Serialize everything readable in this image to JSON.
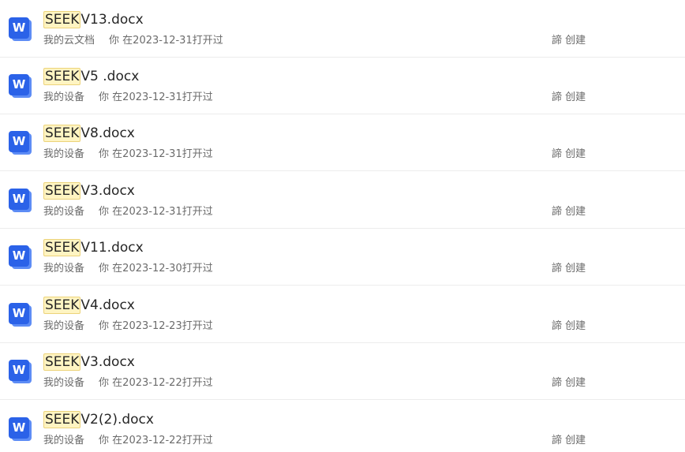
{
  "files": [
    {
      "highlight": "SEEK",
      "name_rest": "V13.docx",
      "location": "我的云文档",
      "opened_by": "你",
      "opened_text": "在2023-12-31打开过",
      "creator": "諦 创建",
      "icon_letter": "W"
    },
    {
      "highlight": "SEEK",
      "name_rest": "V5 .docx",
      "location": "我的设备",
      "opened_by": "你",
      "opened_text": "在2023-12-31打开过",
      "creator": "諦 创建",
      "icon_letter": "W"
    },
    {
      "highlight": "SEEK",
      "name_rest": "V8.docx",
      "location": "我的设备",
      "opened_by": "你",
      "opened_text": "在2023-12-31打开过",
      "creator": "諦 创建",
      "icon_letter": "W"
    },
    {
      "highlight": "SEEK",
      "name_rest": "V3.docx",
      "location": "我的设备",
      "opened_by": "你",
      "opened_text": "在2023-12-31打开过",
      "creator": "諦 创建",
      "icon_letter": "W"
    },
    {
      "highlight": "SEEK",
      "name_rest": "V11.docx",
      "location": "我的设备",
      "opened_by": "你",
      "opened_text": "在2023-12-30打开过",
      "creator": "諦 创建",
      "icon_letter": "W"
    },
    {
      "highlight": "SEEK",
      "name_rest": "V4.docx",
      "location": "我的设备",
      "opened_by": "你",
      "opened_text": "在2023-12-23打开过",
      "creator": "諦 创建",
      "icon_letter": "W"
    },
    {
      "highlight": "SEEK",
      "name_rest": "V3.docx",
      "location": "我的设备",
      "opened_by": "你",
      "opened_text": "在2023-12-22打开过",
      "creator": "諦 创建",
      "icon_letter": "W"
    },
    {
      "highlight": "SEEK",
      "name_rest": "V2(2).docx",
      "location": "我的设备",
      "opened_by": "你",
      "opened_text": "在2023-12-22打开过",
      "creator": "諦 创建",
      "icon_letter": "W"
    }
  ],
  "colors": {
    "icon_blue": "#2b62e8",
    "highlight_bg": "#fff4c2",
    "highlight_border": "#ecd37a"
  }
}
